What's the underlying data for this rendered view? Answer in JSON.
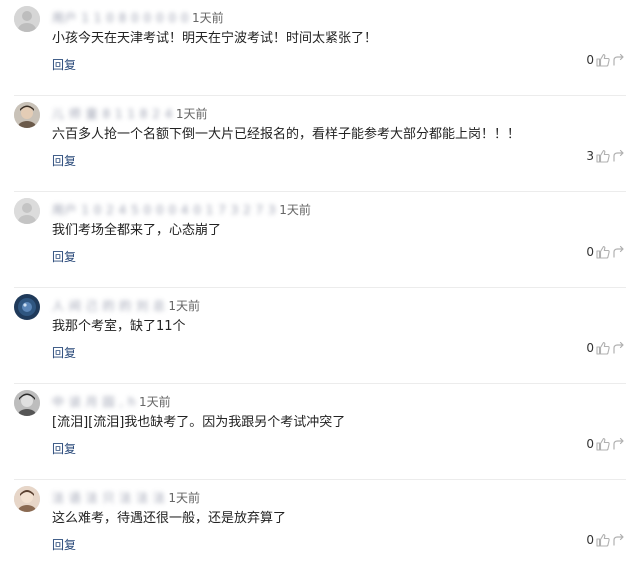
{
  "comments": [
    {
      "username": "用户 1 1 0 8 0 0 0 0 0",
      "time": "1天前",
      "text": "小孩今天在天津考试！明天在宁波考试！时间太紧张了！",
      "reply_label": "回复",
      "likes": "0",
      "avatar": {
        "bg": "#d6d6d6",
        "fg": "#bdbdbd",
        "icon": "default-avatar-icon"
      }
    },
    {
      "username": "儿 师 童 8 1 1 8 2 4",
      "time": "1天前",
      "text": "六百多人抢一个名额下倒一大片已经报名的，看样子能参考大部分都能上岗！！！",
      "reply_label": "回复",
      "likes": "3",
      "avatar": {
        "bg": "#c9c2b8",
        "fg": "#6b5a4a",
        "icon": "photo-avatar-icon"
      }
    },
    {
      "username": "用户 1 0 2 4 5 0 0 0 4 0 1 7 3 2 7 3",
      "time": "1天前",
      "text": "我们考场全都来了，心态崩了",
      "reply_label": "回复",
      "likes": "0",
      "avatar": {
        "bg": "#dcdcdc",
        "fg": "#c4c4c4",
        "icon": "default-avatar-icon"
      }
    },
    {
      "username": "人 间 己 的 的 刘 总",
      "time": "1天前",
      "text": "我那个考室，缺了11个",
      "reply_label": "回复",
      "likes": "0",
      "avatar": {
        "bg": "#1f3a5a",
        "fg": "#5b86b8",
        "icon": "photo-avatar-icon"
      }
    },
    {
      "username": "中 谈 月 园 , h",
      "time": "1天前",
      "text": "[流泪][流泪]我也缺考了。因为我跟另个考试冲突了",
      "reply_label": "回复",
      "likes": "0",
      "avatar": {
        "bg": "#bdbdbd",
        "fg": "#555555",
        "icon": "photo-avatar-icon"
      }
    },
    {
      "username": "法 语 法 只 法 法 法",
      "time": "1天前",
      "text": "这么难考，待遇还很一般，还是放弃算了",
      "reply_label": "回复",
      "likes": "0",
      "avatar": {
        "bg": "#e7d6c8",
        "fg": "#8a6a52",
        "icon": "photo-avatar-icon"
      }
    }
  ],
  "icons": {
    "like": "thumbs-up-icon",
    "share": "share-icon"
  },
  "colors": {
    "reply_link": "#2a4a7a",
    "username": "#8a8fa3",
    "icon_gray": "#b0b0b0"
  }
}
